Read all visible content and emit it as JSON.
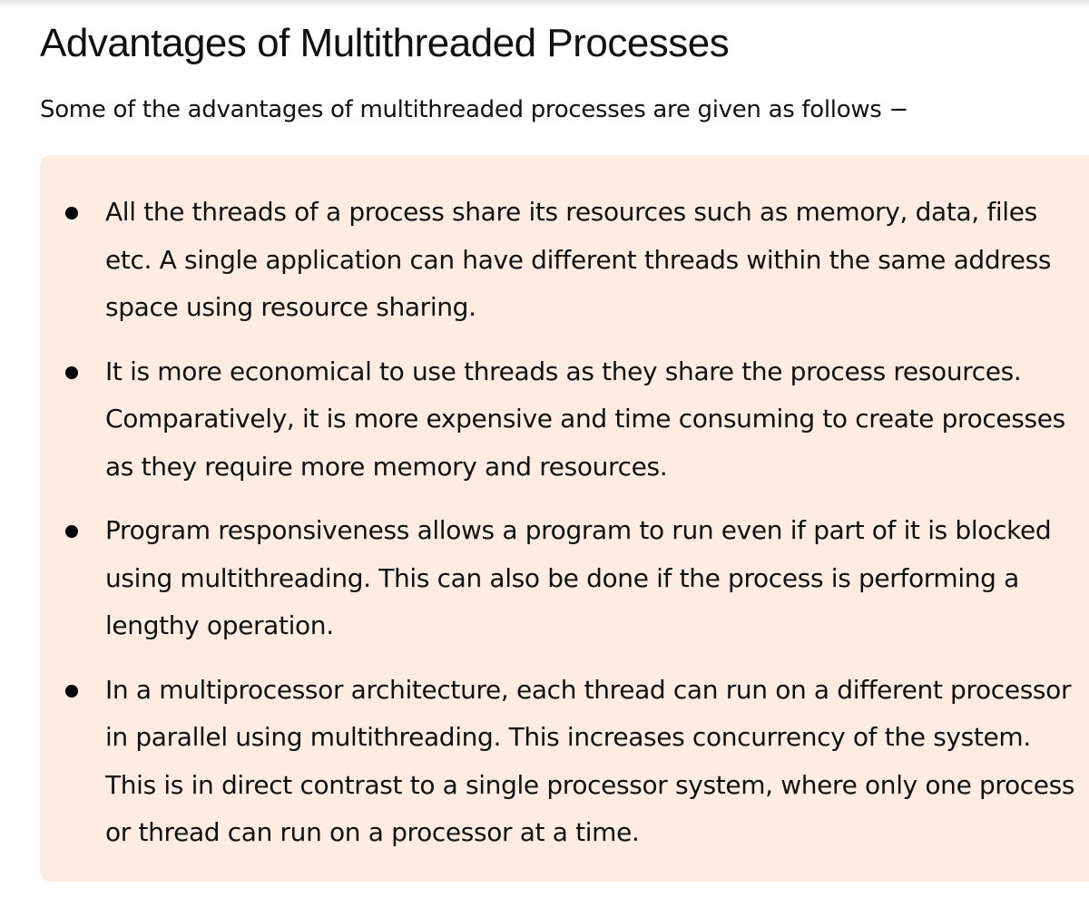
{
  "article": {
    "title": "Advantages of Multithreaded Processes",
    "intro": "Some of the advantages of multithreaded processes are given as follows −",
    "items": [
      "All the threads of a process share its resources such as memory, data, files etc. A single application can have different threads within the same address space using resource sharing.",
      "It is more economical to use threads as they share the process resources. Comparatively, it is more expensive and time consuming to create processes as they require more memory and resources.",
      "Program responsiveness allows a program to run even if part of it is blocked using multithreading. This can also be done if the process is performing a lengthy operation.",
      "In a multiprocessor architecture, each thread can run on a different processor in parallel using multithreading. This increases concurrency of the system. This is in direct contrast to a single processor system, where only one process or thread can run on a processor at a time."
    ]
  },
  "colors": {
    "panel_background": "#fdece1",
    "text": "#111111",
    "bullet": "#000000"
  }
}
